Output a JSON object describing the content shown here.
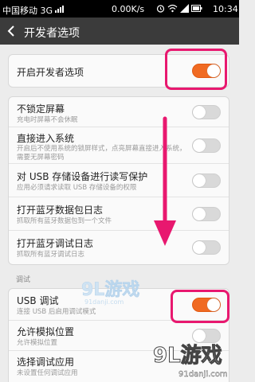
{
  "status_bar": {
    "carrier": "中国移动 3G",
    "speed": "0.00K/s",
    "time": "10:34"
  },
  "titlebar": {
    "title": "开发者选项"
  },
  "developer_options": {
    "label": "开启开发者选项",
    "enabled": true
  },
  "settings": [
    {
      "title": "不锁定屏幕",
      "subtitle": "充电时屏幕不会休眠",
      "enabled": false
    },
    {
      "title": "直接进入系统",
      "subtitle": "开启后不使用系统的锁屏样式，点亮屏幕直接进入系统，",
      "subtitle2": "需要无屏幕密码",
      "enabled": false
    },
    {
      "title": "对 USB 存储设备进行读写保护",
      "subtitle": "应用必须请求读取 USB 存储设备的权限",
      "enabled": false
    },
    {
      "title": "打开蓝牙数据包日志",
      "subtitle": "抓取所有蓝牙数据包到一个文件",
      "enabled": false
    },
    {
      "title": "打开蓝牙调试日志",
      "subtitle": "抓取所有蓝牙调试日志",
      "enabled": false
    }
  ],
  "debug_section": {
    "label": "调试",
    "items": [
      {
        "title": "USB 调试",
        "subtitle": "连接 USB 后启用调试模式",
        "enabled": true
      },
      {
        "title": "允许模拟位置",
        "subtitle": "允许模拟位置",
        "enabled": false
      },
      {
        "title": "选择调试应用",
        "subtitle": "未设置任何调试应用",
        "enabled": null
      }
    ]
  },
  "watermark": {
    "small_brand": "9L游戏",
    "small_url": "91danji.com",
    "big_brand": "9L游戏",
    "big_url": "91danji.com"
  },
  "colors": {
    "accent_orange": "#f06a22",
    "highlight_pink": "#e8186f",
    "titlebar": "#3b3b3b"
  }
}
